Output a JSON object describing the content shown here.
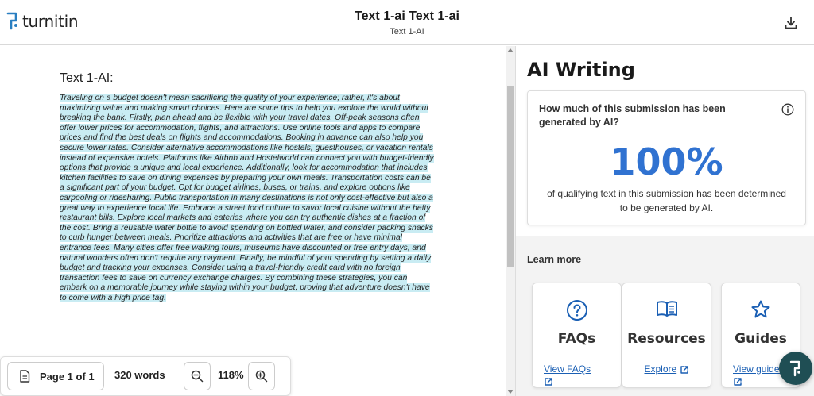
{
  "header": {
    "logo_text": "turnitin",
    "title": "Text 1-ai Text 1-ai",
    "subtitle": "Text 1-AI",
    "download_icon": "download-icon"
  },
  "document": {
    "heading": "Text 1-AI:",
    "body": "Traveling on a budget doesn't mean sacrificing the quality of your experience; rather, it's about maximizing value and making smart choices. Here are some tips to help you explore the world without breaking the bank. Firstly, plan ahead and be flexible with your travel dates. Off-peak seasons often offer lower prices for accommodation, flights, and attractions. Use online tools and apps to compare prices and find the best deals on flights and accommodations. Booking in advance can also help you secure lower rates. Consider alternative accommodations like hostels, guesthouses, or vacation rentals instead of expensive hotels. Platforms like Airbnb and Hostelworld can connect you with budget-friendly options that provide a unique and local experience. Additionally, look for accommodation that includes kitchen facilities to save on dining expenses by preparing your own meals. Transportation costs can be a significant part of your budget. Opt for budget airlines, buses, or trains, and explore options like carpooling or ridesharing. Public transportation in many destinations is not only cost-effective but also a great way to experience local life. Embrace a street food culture to savor local cuisine without the hefty restaurant bills. Explore local markets and eateries where you can try authentic dishes at a fraction of the cost. Bring a reusable water bottle to avoid spending on bottled water, and consider packing snacks to curb hunger between meals. Prioritize attractions and activities that are free or have minimal entrance fees. Many cities offer free walking tours, museums have discounted or free entry days, and natural wonders often don't require any payment. Finally, be mindful of your spending by setting a daily budget and tracking your expenses. Consider using a travel-friendly credit card with no foreign transaction fees to save on currency exchange charges. By combining these strategies, you can embark on a memorable journey while staying within your budget, proving that adventure doesn't have to come with a high price tag."
  },
  "toolbar": {
    "page_label": "Page 1 of 1",
    "word_count": "320 words",
    "zoom": "118%"
  },
  "panel": {
    "title": "AI Writing",
    "question": "How much of this submission has been generated by AI?",
    "percent": "100%",
    "description": "of qualifying text in this submission has been determined to be generated by AI.",
    "learn_more": "Learn more",
    "cards": [
      {
        "title": "FAQs",
        "link": "View FAQs"
      },
      {
        "title": "Resources",
        "link": "Explore"
      },
      {
        "title": "Guides",
        "link": "View guides"
      }
    ]
  },
  "colors": {
    "accent": "#3072d1",
    "highlight": "#c9ecf3",
    "fab": "#1f4e54",
    "logo_blue": "#2a7fc1"
  }
}
